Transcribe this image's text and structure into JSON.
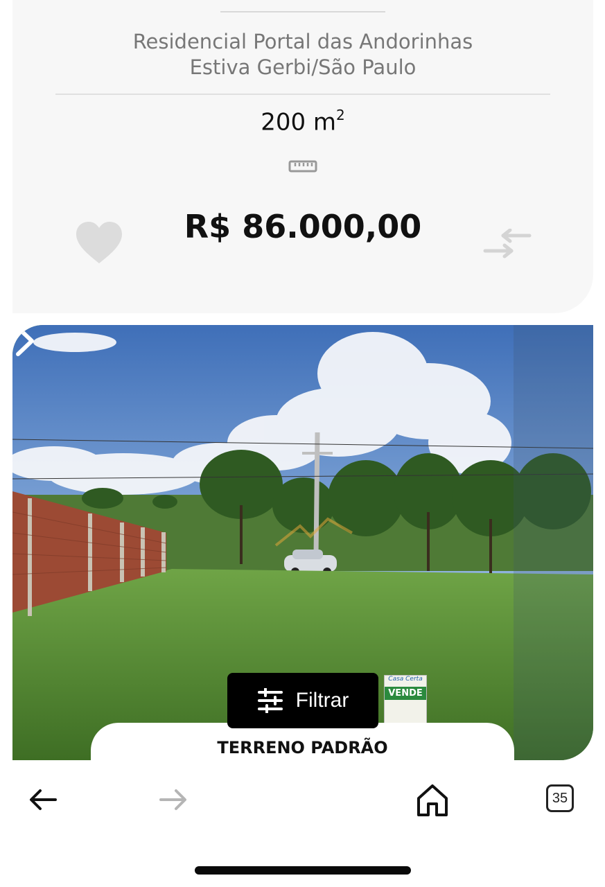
{
  "listing": {
    "location_line1": "Residencial Portal das Andorinhas",
    "location_line2": "Estiva Gerbi/São Paulo",
    "area_value": "200 m",
    "area_unit_sup": "2",
    "price": "R$ 86.000,00",
    "icons": {
      "ruler": "ruler-icon",
      "favorite": "heart-icon",
      "compare": "compare-arrows-icon"
    }
  },
  "photo": {
    "sign_brand": "Casa Certa",
    "sign_text": "VENDE",
    "next_icon": "chevron-right-icon"
  },
  "filter_button": {
    "label": "Filtrar",
    "icon": "sliders-icon"
  },
  "type_tab": {
    "label": "TERRENO PADRÃO"
  },
  "browser_bar": {
    "back_icon": "arrow-left-icon",
    "forward_icon": "arrow-right-icon",
    "home_icon": "home-icon",
    "tab_count": "35"
  },
  "colors": {
    "price": "#111111",
    "muted": "#777777",
    "filter_bg": "#000000"
  }
}
